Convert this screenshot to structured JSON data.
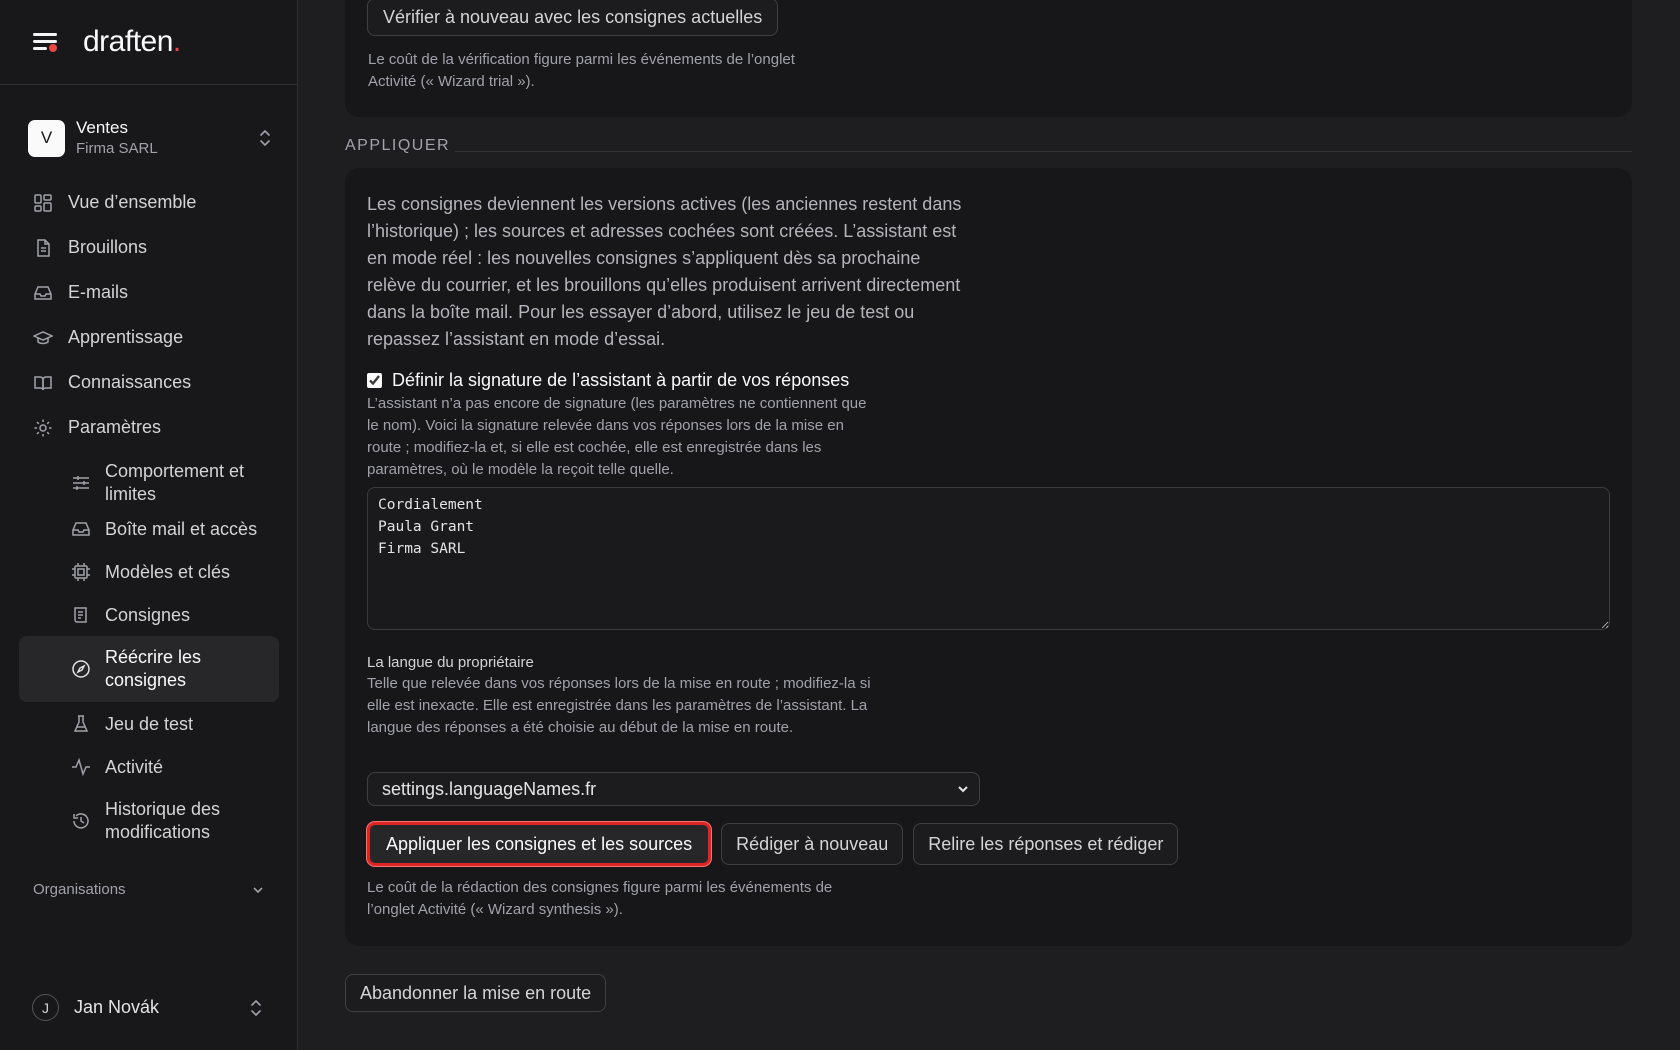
{
  "app": {
    "brand": "draften",
    "brand_dot": "."
  },
  "workspace": {
    "initial": "V",
    "name": "Ventes",
    "company": "Firma SARL"
  },
  "nav": {
    "overview": "Vue d’ensemble",
    "drafts": "Brouillons",
    "emails": "E-mails",
    "learning": "Apprentissage",
    "knowledge": "Connaissances",
    "settings": "Paramètres",
    "sub": {
      "behavior": "Comportement et limites",
      "mailbox": "Boîte mail et accès",
      "models": "Modèles et clés",
      "instructions": "Consignes",
      "rewrite": "Réécrire les consignes",
      "testset": "Jeu de test",
      "activity": "Activité",
      "history": "Historique des modifications"
    }
  },
  "organizations": {
    "label": "Organisations"
  },
  "user": {
    "initial": "J",
    "name": "Jan Novák"
  },
  "verify": {
    "button": "Vérifier à nouveau avec les consignes actuelles",
    "hint": "Le coût de la vérification figure parmi les événements de l’onglet Activité (« Wizard trial »)."
  },
  "apply": {
    "section_label": "APPLIQUER",
    "intro": "Les consignes deviennent les versions actives (les anciennes restent dans l’historique) ; les sources et adresses cochées sont créées. L’assistant est en mode réel : les nouvelles consignes s’appliquent dès sa prochaine relève du courrier, et les brouillons qu’elles produisent arrivent directement dans la boîte mail. Pour les essayer d’abord, utilisez le jeu de test ou repassez l’assistant en mode d’essai.",
    "signature_checkbox": {
      "label": "Définir la signature de l’assistant à partir de vos réponses",
      "checked": true
    },
    "signature_hint": "L’assistant n’a pas encore de signature (les paramètres ne contiennent que le nom). Voici la signature relevée dans vos réponses lors de la mise en route ; modifiez-la et, si elle est cochée, elle est enregistrée dans les paramètres, où le modèle la reçoit telle quelle.",
    "signature_value": "Cordialement\nPaula Grant\nFirma SARL",
    "language_label": "La langue du propriétaire",
    "language_hint": "Telle que relevée dans vos réponses lors de la mise en route ; modifiez-la si elle est inexacte. Elle est enregistrée dans les paramètres de l’assistant. La langue des réponses a été choisie au début de la mise en route.",
    "language_value": "settings.languageNames.fr",
    "primary_button": "Appliquer les consignes et les sources",
    "redraft_button": "Rédiger à nouveau",
    "reread_button": "Relire les réponses et rédiger",
    "cost_hint": "Le coût de la rédaction des consignes figure parmi les événements de l’onglet Activité (« Wizard synthesis »)."
  },
  "abandon_button": "Abandonner la mise en route",
  "colors": {
    "accent": "#ef4444",
    "focus_ring": "#dc2626",
    "background": "#1e1e21",
    "sidebar": "#18181b",
    "card": "#17171a"
  }
}
